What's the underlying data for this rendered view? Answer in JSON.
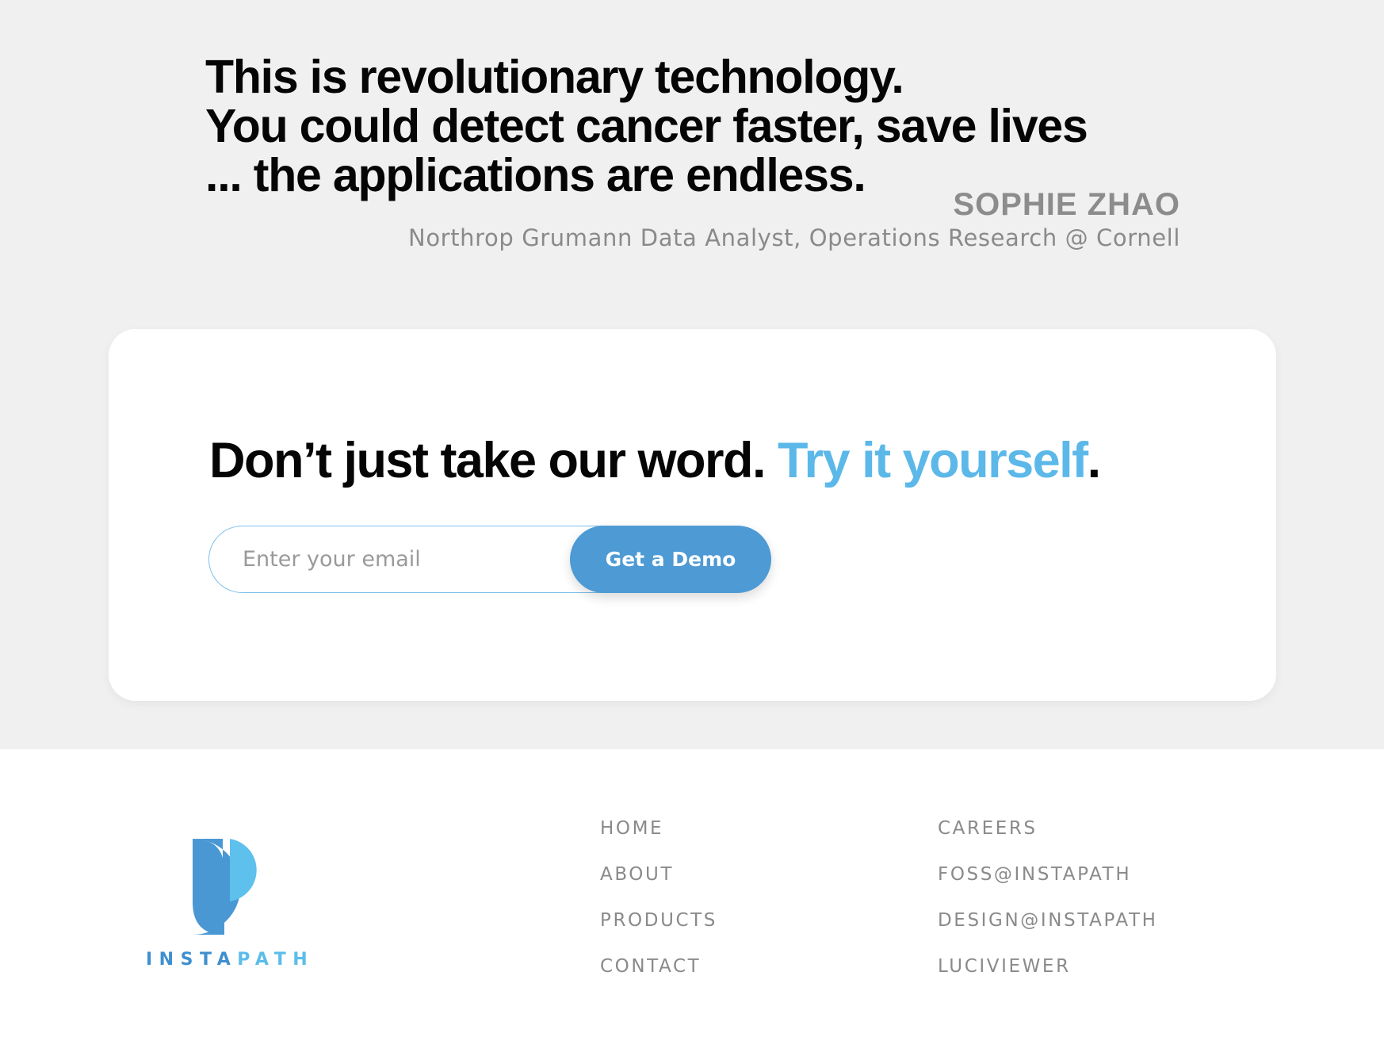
{
  "testimonial": {
    "quote_lines": [
      "This is revolutionary technology.",
      "You could detect cancer faster, save lives",
      "... the applications are endless."
    ],
    "author_name": "SOPHIE ZHAO",
    "author_role": "Northrop Grumann Data Analyst, Operations Research @ Cornell"
  },
  "cta": {
    "heading_main": "Don’t just take our word. ",
    "heading_accent": "Try it yourself",
    "heading_end": ".",
    "email_placeholder": "Enter your email",
    "email_value": "",
    "button_label": "Get a Demo"
  },
  "footer": {
    "logo": {
      "icon": "instapath-p-logo-icon",
      "text_part_1": "INSTA",
      "text_part_2": "PATH"
    },
    "column_1": [
      "HOME",
      "ABOUT",
      "PRODUCTS",
      "CONTACT"
    ],
    "column_2": [
      "CAREERS",
      "FOSS@INSTAPATH",
      "DESIGN@INSTAPATH",
      "LUCIVIEWER"
    ]
  },
  "colors": {
    "background_top": "#f0f0f0",
    "accent_text": "#5bb8e8",
    "button": "#4d9ad4",
    "muted_text": "#8a8a8a",
    "logo_dark_blue": "#4a98d3",
    "logo_light_blue": "#5ec0ed"
  }
}
